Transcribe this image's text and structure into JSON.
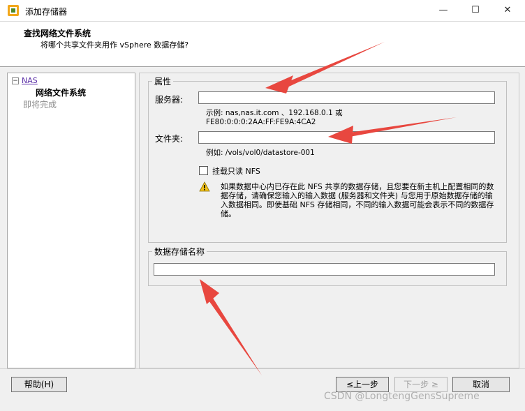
{
  "window": {
    "title": "添加存储器",
    "minimize_glyph": "—",
    "maximize_glyph": "☐",
    "close_glyph": "✕"
  },
  "header": {
    "title": "查找网络文件系统",
    "subtitle": "将哪个共享文件夹用作 vSphere 数据存储?"
  },
  "nav": {
    "toggle": "−",
    "items": [
      {
        "label": "NAS"
      },
      {
        "label": "网络文件系统"
      },
      {
        "label": "即将完成"
      }
    ]
  },
  "properties": {
    "legend": "属性",
    "server_label": "服务器:",
    "server_value": "",
    "server_hint_line1": "示例: nas,nas.it.com 、192.168.0.1 或",
    "server_hint_line2": "FE80:0:0:0:2AA:FF:FE9A:4CA2",
    "folder_label": "文件夹:",
    "folder_value": "",
    "folder_hint": "例如: /vols/vol0/datastore-001",
    "readonly_label": "挂载只读 NFS",
    "readonly_checked": false,
    "warning_text": "如果数据中心内已存在此 NFS 共享的数据存储，且您要在新主机上配置相同的数据存储，请确保您输入的输入数据 (服务器和文件夹) 与您用于原始数据存储的输入数据相同。即使基础 NFS 存储相同，不同的输入数据可能会表示不同的数据存储。"
  },
  "datastore": {
    "legend": "数据存储名称",
    "name_value": ""
  },
  "buttons": {
    "help": "帮助(H)",
    "back": "≤上一步",
    "next": "下一步 ≥",
    "cancel": "取消"
  },
  "watermark": "CSDN @LongtengGensSupreme",
  "colors": {
    "arrow": "#e8473f",
    "link": "#5a2ea6",
    "warning": "#f2c21a"
  },
  "icons": [
    "vsphere-storage-icon",
    "warning-icon"
  ]
}
